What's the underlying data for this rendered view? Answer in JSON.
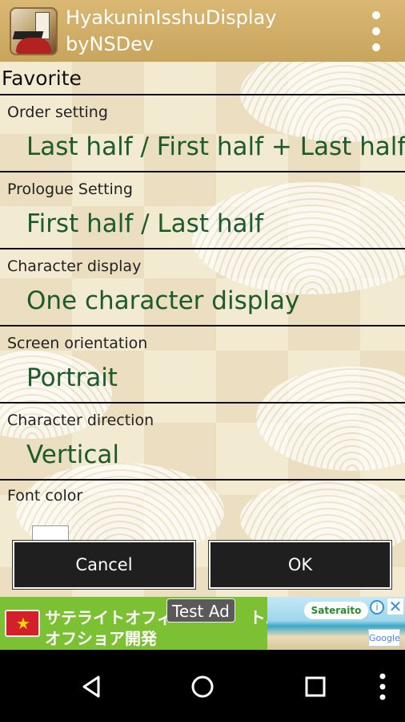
{
  "app": {
    "title_line1": "HyakuninIsshuDisplay",
    "title_line2": "byNSDev"
  },
  "dialog": {
    "header": "Favorite",
    "settings": [
      {
        "label": "Order setting",
        "value": "Last half / First half + Last half"
      },
      {
        "label": "Prologue Setting",
        "value": "First half / Last half"
      },
      {
        "label": "Character display",
        "value": "One character display"
      },
      {
        "label": "Screen orientation",
        "value": "Portrait"
      },
      {
        "label": "Character direction",
        "value": "Vertical"
      }
    ],
    "font_color_label": "Font color",
    "font_color_value": "#ffffff",
    "cancel_label": "Cancel",
    "ok_label": "OK"
  },
  "ad": {
    "line1": "サテライトオフィ",
    "line1_tail": "トム",
    "line2": "オフショア開発",
    "badge": "Test Ad",
    "logo": "Sateraito",
    "google": "Google"
  },
  "colors": {
    "appbar": "#c8a55d",
    "value_text": "#1d5a2e",
    "ad_background": "#7cc034"
  },
  "icons": {
    "menu": "overflow-menu-icon",
    "back": "back-triangle-icon",
    "home": "home-circle-icon",
    "recents": "recents-square-icon",
    "nav_menu": "more-vertical-icon"
  }
}
